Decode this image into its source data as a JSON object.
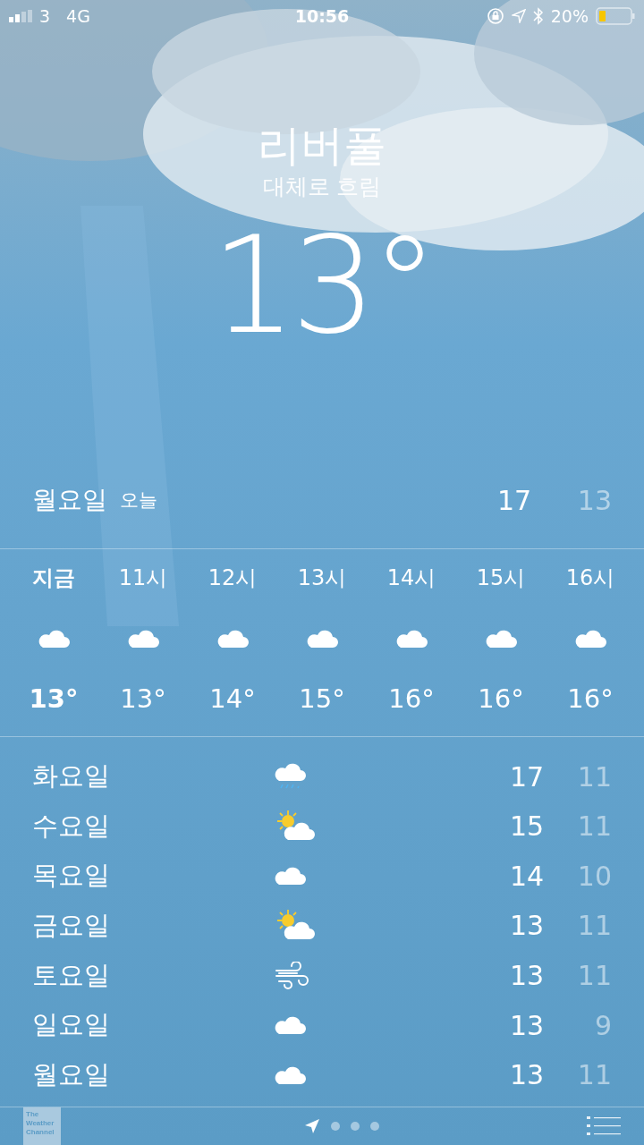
{
  "status_bar": {
    "carrier": "3",
    "network": "4G",
    "time": "10:56",
    "battery_percent": "20%"
  },
  "location": {
    "city": "리버풀",
    "condition": "대체로 흐림",
    "temperature": "13°"
  },
  "today": {
    "day": "월요일",
    "label": "오늘",
    "high": "17",
    "low": "13"
  },
  "hourly": [
    {
      "time": "지금",
      "kind": "cloud",
      "temp": "13°",
      "now": true
    },
    {
      "time": "11시",
      "kind": "cloud",
      "temp": "13°",
      "now": false
    },
    {
      "time": "12시",
      "kind": "cloud",
      "temp": "14°",
      "now": false
    },
    {
      "time": "13시",
      "kind": "cloud",
      "temp": "15°",
      "now": false
    },
    {
      "time": "14시",
      "kind": "cloud",
      "temp": "16°",
      "now": false
    },
    {
      "time": "15시",
      "kind": "cloud",
      "temp": "16°",
      "now": false
    },
    {
      "time": "16시",
      "kind": "cloud",
      "temp": "16°",
      "now": false
    }
  ],
  "daily": [
    {
      "day": "화요일",
      "kind": "rain",
      "high": "17",
      "low": "11"
    },
    {
      "day": "수요일",
      "kind": "partly-sunny",
      "high": "15",
      "low": "11"
    },
    {
      "day": "목요일",
      "kind": "cloud",
      "high": "14",
      "low": "10"
    },
    {
      "day": "금요일",
      "kind": "partly-sunny",
      "high": "13",
      "low": "11"
    },
    {
      "day": "토요일",
      "kind": "wind",
      "high": "13",
      "low": "11"
    },
    {
      "day": "일요일",
      "kind": "cloud",
      "high": "13",
      "low": "9"
    },
    {
      "day": "월요일",
      "kind": "cloud",
      "high": "13",
      "low": "11"
    }
  ],
  "footer": {
    "logo_lines": [
      "The",
      "Weather",
      "Channel"
    ],
    "pages": [
      {
        "kind": "location",
        "selected": true
      },
      {
        "kind": "dot",
        "selected": false
      },
      {
        "kind": "dot",
        "selected": false
      },
      {
        "kind": "dot",
        "selected": false
      }
    ]
  }
}
